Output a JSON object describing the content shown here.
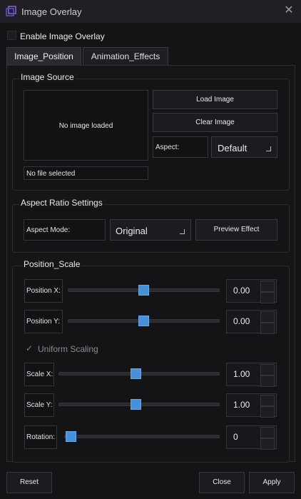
{
  "window": {
    "title": "Image Overlay"
  },
  "enable_overlay": {
    "label": "Enable Image Overlay",
    "checked": false
  },
  "tabs": [
    {
      "label": "Image_Position",
      "active": true
    },
    {
      "label": "Animation_Effects",
      "active": false
    }
  ],
  "image_source": {
    "title": "Image Source",
    "preview_text": "No image loaded",
    "load_label": "Load Image",
    "clear_label": "Clear Image",
    "aspect_label": "Aspect:",
    "aspect_value": "Default",
    "file_text": "No file selected"
  },
  "aspect_settings": {
    "title": "Aspect Ratio Settings",
    "mode_label": "Aspect Mode:",
    "mode_value": "Original",
    "preview_label": "Preview Effect"
  },
  "position_scale": {
    "title": "Position_Scale",
    "uniform_label": "Uniform Scaling",
    "uniform_checked": true,
    "sliders": [
      {
        "label": "Position X:",
        "value": "0.00",
        "fraction": 0.5
      },
      {
        "label": "Position Y:",
        "value": "0.00",
        "fraction": 0.5
      },
      {
        "label": "Scale X:",
        "value": "1.00",
        "fraction": 0.48
      },
      {
        "label": "Scale Y:",
        "value": "1.00",
        "fraction": 0.48
      },
      {
        "label": "Rotation:",
        "value": "0",
        "fraction": 0.0
      }
    ]
  },
  "footer": {
    "reset_label": "Reset",
    "close_label": "Close",
    "apply_label": "Apply"
  },
  "colors": {
    "accent": "#4a90d9",
    "background": "#141417",
    "titlebar": "#202024"
  }
}
